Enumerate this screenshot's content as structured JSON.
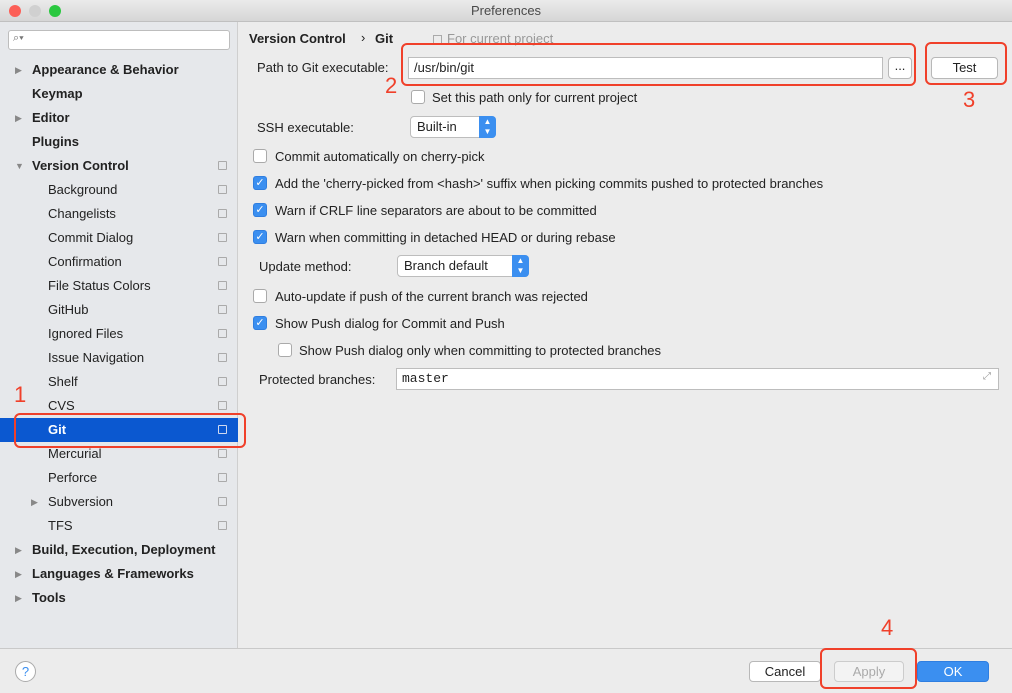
{
  "window": {
    "title": "Preferences"
  },
  "sidebar": {
    "search_placeholder": "",
    "items": [
      {
        "label": "Appearance & Behavior",
        "bold": true,
        "arrow": "right",
        "indent": 0
      },
      {
        "label": "Keymap",
        "bold": true,
        "indent": 0
      },
      {
        "label": "Editor",
        "bold": true,
        "arrow": "right",
        "indent": 0
      },
      {
        "label": "Plugins",
        "bold": true,
        "indent": 0
      },
      {
        "label": "Version Control",
        "bold": true,
        "arrow": "down",
        "indent": 0,
        "project": true
      },
      {
        "label": "Background",
        "indent": 1,
        "project": true
      },
      {
        "label": "Changelists",
        "indent": 1,
        "project": true
      },
      {
        "label": "Commit Dialog",
        "indent": 1,
        "project": true
      },
      {
        "label": "Confirmation",
        "indent": 1,
        "project": true
      },
      {
        "label": "File Status Colors",
        "indent": 1,
        "project": true
      },
      {
        "label": "GitHub",
        "indent": 1,
        "project": true
      },
      {
        "label": "Ignored Files",
        "indent": 1,
        "project": true
      },
      {
        "label": "Issue Navigation",
        "indent": 1,
        "project": true
      },
      {
        "label": "Shelf",
        "indent": 1,
        "project": true
      },
      {
        "label": "CVS",
        "indent": 1,
        "project": true
      },
      {
        "label": "Git",
        "indent": 1,
        "project": true,
        "selected": true
      },
      {
        "label": "Mercurial",
        "indent": 1,
        "project": true
      },
      {
        "label": "Perforce",
        "indent": 1,
        "project": true
      },
      {
        "label": "Subversion",
        "indent": 1,
        "project": true,
        "arrow": "right"
      },
      {
        "label": "TFS",
        "indent": 1,
        "project": true
      },
      {
        "label": "Build, Execution, Deployment",
        "bold": true,
        "arrow": "right",
        "indent": 0
      },
      {
        "label": "Languages & Frameworks",
        "bold": true,
        "arrow": "right",
        "indent": 0
      },
      {
        "label": "Tools",
        "bold": true,
        "arrow": "right",
        "indent": 0
      }
    ]
  },
  "breadcrumb": {
    "parent": "Version Control",
    "separator": "›",
    "current": "Git",
    "scope": "For current project"
  },
  "git": {
    "path_label": "Path to Git executable:",
    "path_value": "/usr/bin/git",
    "browse_label": "...",
    "test_label": "Test",
    "set_path_only": {
      "label": "Set this path only for current project",
      "checked": false
    },
    "ssh_label": "SSH executable:",
    "ssh_value": "Built-in",
    "options": [
      {
        "label": "Commit automatically on cherry-pick",
        "checked": false
      },
      {
        "label": "Add the 'cherry-picked from <hash>' suffix when picking commits pushed to protected branches",
        "checked": true
      },
      {
        "label": "Warn if CRLF line separators are about to be committed",
        "checked": true
      },
      {
        "label": "Warn when committing in detached HEAD or during rebase",
        "checked": true
      }
    ],
    "update_label": "Update method:",
    "update_value": "Branch default",
    "auto_update": {
      "label": "Auto-update if push of the current branch was rejected",
      "checked": false
    },
    "show_push": {
      "label": "Show Push dialog for Commit and Push",
      "checked": true
    },
    "show_push_protected": {
      "label": "Show Push dialog only when committing to protected branches",
      "checked": false
    },
    "protected_label": "Protected branches:",
    "protected_value": "master"
  },
  "annotations": [
    "1",
    "2",
    "3",
    "4"
  ],
  "footer": {
    "help": "?",
    "cancel": "Cancel",
    "apply": "Apply",
    "ok": "OK"
  },
  "colors": {
    "selection": "#0b58d0",
    "accent": "#3b8ff0",
    "annotation": "#f0402a"
  }
}
